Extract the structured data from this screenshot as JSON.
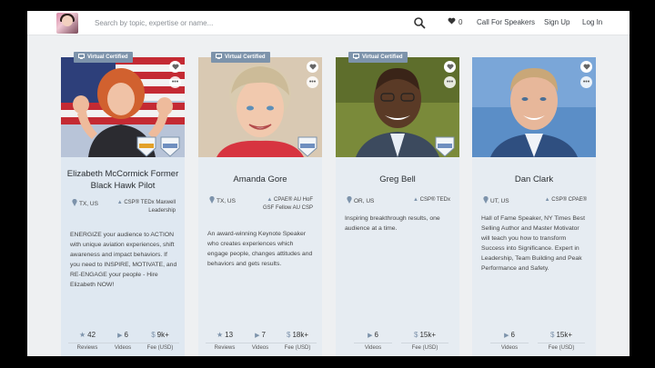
{
  "nav": {
    "search_placeholder": "Search by topic, expertise or name...",
    "favorites_count": "0",
    "links": [
      "Call For Speakers",
      "Sign Up",
      "Log In"
    ]
  },
  "badge_label": "Virtual Certified",
  "colors": {
    "accent": "#7d93ab",
    "card_bg": "#e6ecf2",
    "page_bg": "#eef0f2"
  },
  "cards": [
    {
      "name": "Elizabeth McCormick Former Black Hawk Pilot",
      "location": "TX, US",
      "credentials": "CSP® TEDx Maxwell Leadership",
      "description": "ENERGIZE your audience to ACTION with unique aviation experiences, shift awareness and impact behaviors. If you need to INSPIRE, MOTIVATE, and RE-ENGAGE your people - Hire Elizabeth NOW!",
      "virtual_certified": true,
      "stats": [
        {
          "icon": "star-icon",
          "value": "42",
          "label": "Reviews"
        },
        {
          "icon": "video-icon",
          "value": "6",
          "label": "Videos"
        },
        {
          "icon": "dollar-icon",
          "value": "9k+",
          "label": "Fee (USD)"
        }
      ]
    },
    {
      "name": "Amanda Gore",
      "location": "TX, US",
      "credentials": "CPAE® AU HoF GSF Fellow AU CSP",
      "description": "An award-winning Keynote Speaker who creates experiences which engage people, changes attitudes and behaviors and gets results.",
      "virtual_certified": true,
      "stats": [
        {
          "icon": "star-icon",
          "value": "13",
          "label": "Reviews"
        },
        {
          "icon": "video-icon",
          "value": "7",
          "label": "Videos"
        },
        {
          "icon": "dollar-icon",
          "value": "18k+",
          "label": "Fee (USD)"
        }
      ]
    },
    {
      "name": "Greg Bell",
      "location": "OR, US",
      "credentials": "CSP® TEDx",
      "description": "Inspiring breakthrough results, one audience at a time.",
      "virtual_certified": true,
      "stats": [
        {
          "icon": "video-icon",
          "value": "6",
          "label": "Videos"
        },
        {
          "icon": "dollar-icon",
          "value": "15k+",
          "label": "Fee (USD)"
        }
      ]
    },
    {
      "name": "Dan Clark",
      "location": "UT, US",
      "credentials": "CSP® CPAE®",
      "description": "Hall of Fame Speaker, NY Times Best Selling Author and Master Motivator will teach you how to transform Success into Significance. Expert in Leadership, Team Building and Peak Performance and Safety.",
      "virtual_certified": false,
      "stats": [
        {
          "icon": "video-icon",
          "value": "6",
          "label": "Videos"
        },
        {
          "icon": "dollar-icon",
          "value": "15k+",
          "label": "Fee (USD)"
        }
      ]
    }
  ]
}
